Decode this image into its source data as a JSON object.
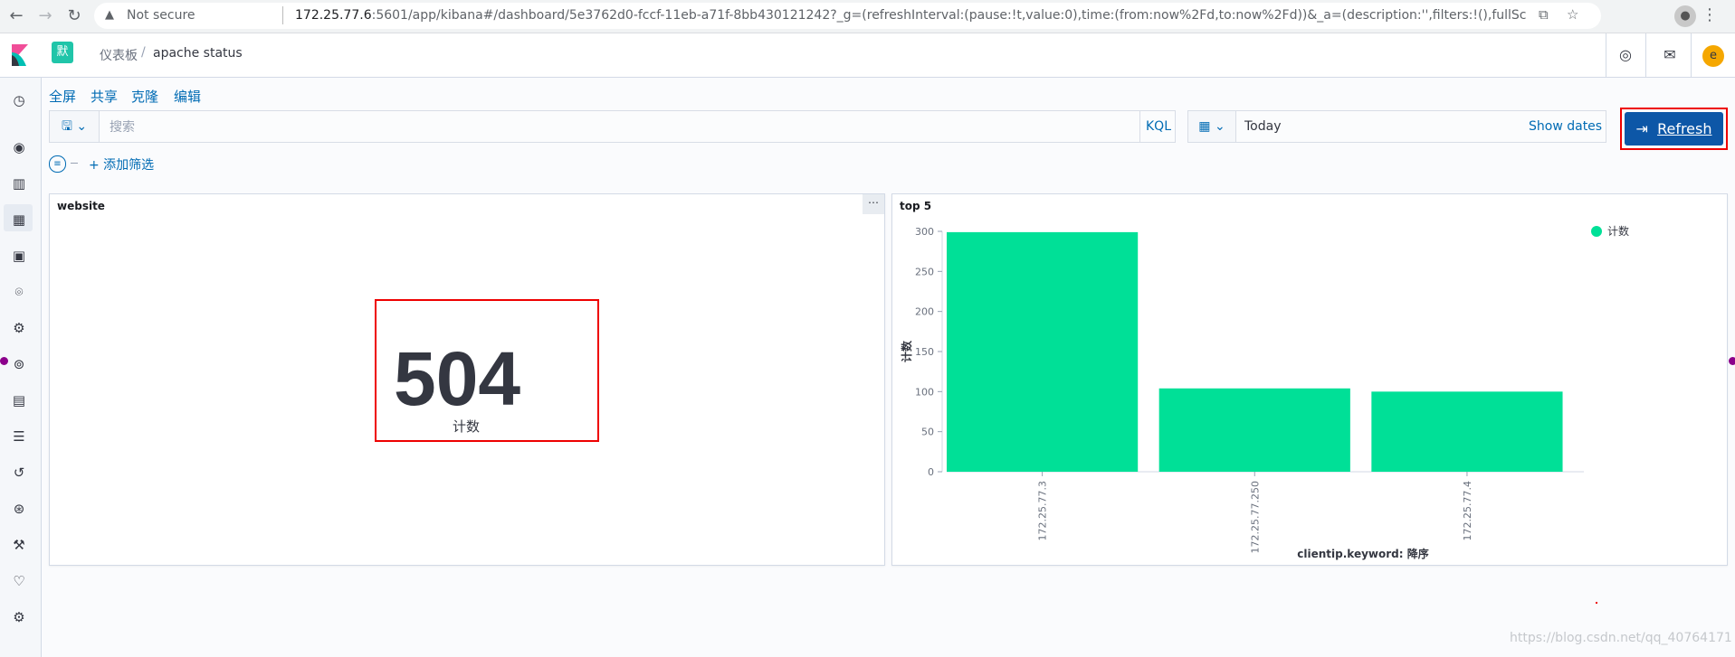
{
  "browser": {
    "security_label": "Not secure",
    "url_host": "172.25.77.6",
    "url_rest": ":5601/app/kibana#/dashboard/5e3762d0-fccf-11eb-a71f-8bb430121242?_g=(refreshInterval:(pause:!t,value:0),time:(from:now%2Fd,to:now%2Fd))&_a=(description:'',filters:!(),fullScreenMode:!f,options:(hidePanelTitles:!f,useMargins:!t),p..."
  },
  "header": {
    "space_initial": "默",
    "breadcrumb_parent": "仪表板",
    "breadcrumb_current": "apache status",
    "user_initial": "e"
  },
  "top_menu": {
    "fullscreen": "全屏",
    "share": "共享",
    "clone": "克隆",
    "edit": "编辑"
  },
  "query": {
    "placeholder": "搜索",
    "language": "KQL"
  },
  "time": {
    "value": "Today",
    "show_dates": "Show dates"
  },
  "refresh_label": "Refresh",
  "add_filter": "+ 添加筛选",
  "panels": {
    "metric": {
      "title": "website",
      "value": "504",
      "label": "计数"
    },
    "bar": {
      "title": "top 5"
    }
  },
  "chart_data": {
    "type": "bar",
    "title": "top 5",
    "categories": [
      "172.25.77.3",
      "172.25.77.250",
      "172.25.77.4"
    ],
    "values": [
      299,
      104,
      100
    ],
    "xlabel": "clientip.keyword: 降序",
    "ylabel": "计数",
    "ylim": [
      0,
      300
    ],
    "yticks": [
      0,
      50,
      100,
      150,
      200,
      250,
      300
    ],
    "legend": {
      "label": "计数",
      "position": "top-right"
    },
    "color": "#00e097",
    "grid": false
  },
  "watermark": "https://blog.csdn.net/qq_40764171"
}
